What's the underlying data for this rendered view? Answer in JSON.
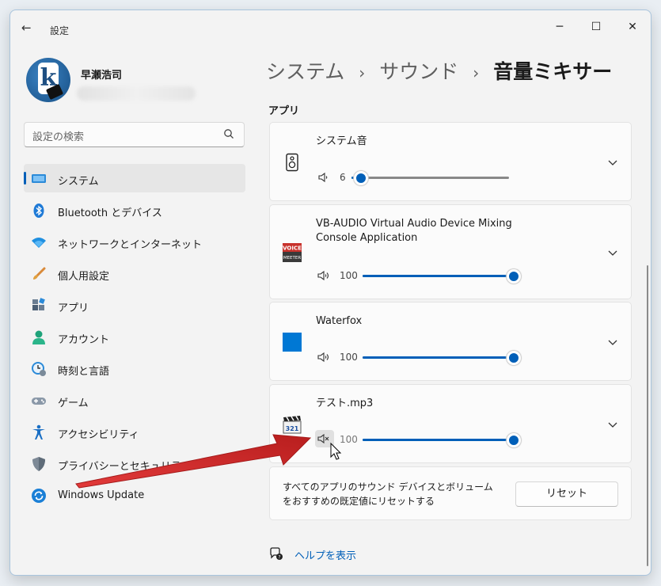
{
  "window": {
    "title": "設定",
    "back_icon": "back-arrow-icon",
    "controls": [
      "minimize-icon",
      "maximize-icon",
      "close-icon"
    ]
  },
  "user": {
    "name": "早瀬浩司"
  },
  "search": {
    "placeholder": "設定の検索",
    "icon": "search-icon"
  },
  "sidebar": {
    "items": [
      {
        "label": "システム",
        "icon": "system-icon",
        "active": true
      },
      {
        "label": "Bluetooth とデバイス",
        "icon": "bluetooth-icon"
      },
      {
        "label": "ネットワークとインターネット",
        "icon": "wifi-icon"
      },
      {
        "label": "個人用設定",
        "icon": "brush-icon"
      },
      {
        "label": "アプリ",
        "icon": "apps-icon"
      },
      {
        "label": "アカウント",
        "icon": "account-icon"
      },
      {
        "label": "時刻と言語",
        "icon": "time-language-icon"
      },
      {
        "label": "ゲーム",
        "icon": "gamepad-icon"
      },
      {
        "label": "アクセシビリティ",
        "icon": "accessibility-icon"
      },
      {
        "label": "プライバシーとセキュリティ",
        "icon": "shield-icon"
      },
      {
        "label": "Windows Update",
        "icon": "windows-update-icon"
      }
    ]
  },
  "breadcrumb": {
    "items": [
      "システム",
      "サウンド"
    ],
    "current": "音量ミキサー",
    "separator": "›"
  },
  "section": {
    "label": "アプリ"
  },
  "apps": [
    {
      "name": "システム音",
      "volume": "6",
      "level": 0.06,
      "muted": false,
      "icon": "speaker-device-icon"
    },
    {
      "name": "VB-AUDIO Virtual Audio Device Mixing Console Application",
      "volume": "100",
      "level": 1.0,
      "muted": false,
      "icon": "voicemeeter-icon",
      "icon_text_top": "VOICE",
      "icon_text_bottom": "MEETER"
    },
    {
      "name": "Waterfox",
      "volume": "100",
      "level": 1.0,
      "muted": false,
      "icon": "waterfox-icon"
    },
    {
      "name": "テスト.mp3",
      "volume": "100",
      "level": 1.0,
      "muted": true,
      "icon": "media-player-clapper-icon",
      "icon_text": "321"
    }
  ],
  "reset": {
    "text": "すべてのアプリのサウンド デバイスとボリュームをおすすめの既定値にリセットする",
    "button": "リセット"
  },
  "help": {
    "label": "ヘルプを表示",
    "icon": "help-chat-icon"
  },
  "colors": {
    "accent": "#005fb8",
    "annotation_arrow": "#d62a2a"
  }
}
